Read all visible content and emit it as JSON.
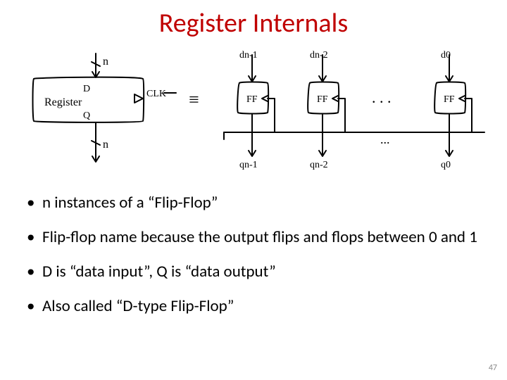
{
  "title": "Register Internals",
  "bullets": [
    "n instances of a “Flip-Flop”",
    "Flip-flop name because the output flips and flops between 0 and 1",
    "D is “data input”, Q is “data output”",
    "Also called “D-type Flip-Flop”"
  ],
  "page_number": "47",
  "diagram": {
    "register_block": {
      "label": "Register",
      "d": "D",
      "q": "Q",
      "clk": "CLK"
    },
    "bus_top": "n",
    "bus_bottom": "n",
    "equiv": "≡",
    "ff_label": "FF",
    "in_labels": [
      "dn-1",
      "dn-2",
      "d0"
    ],
    "out_labels": [
      "qn-1",
      "qn-2",
      "q0"
    ],
    "dots": ". . .",
    "dots2": "..."
  }
}
